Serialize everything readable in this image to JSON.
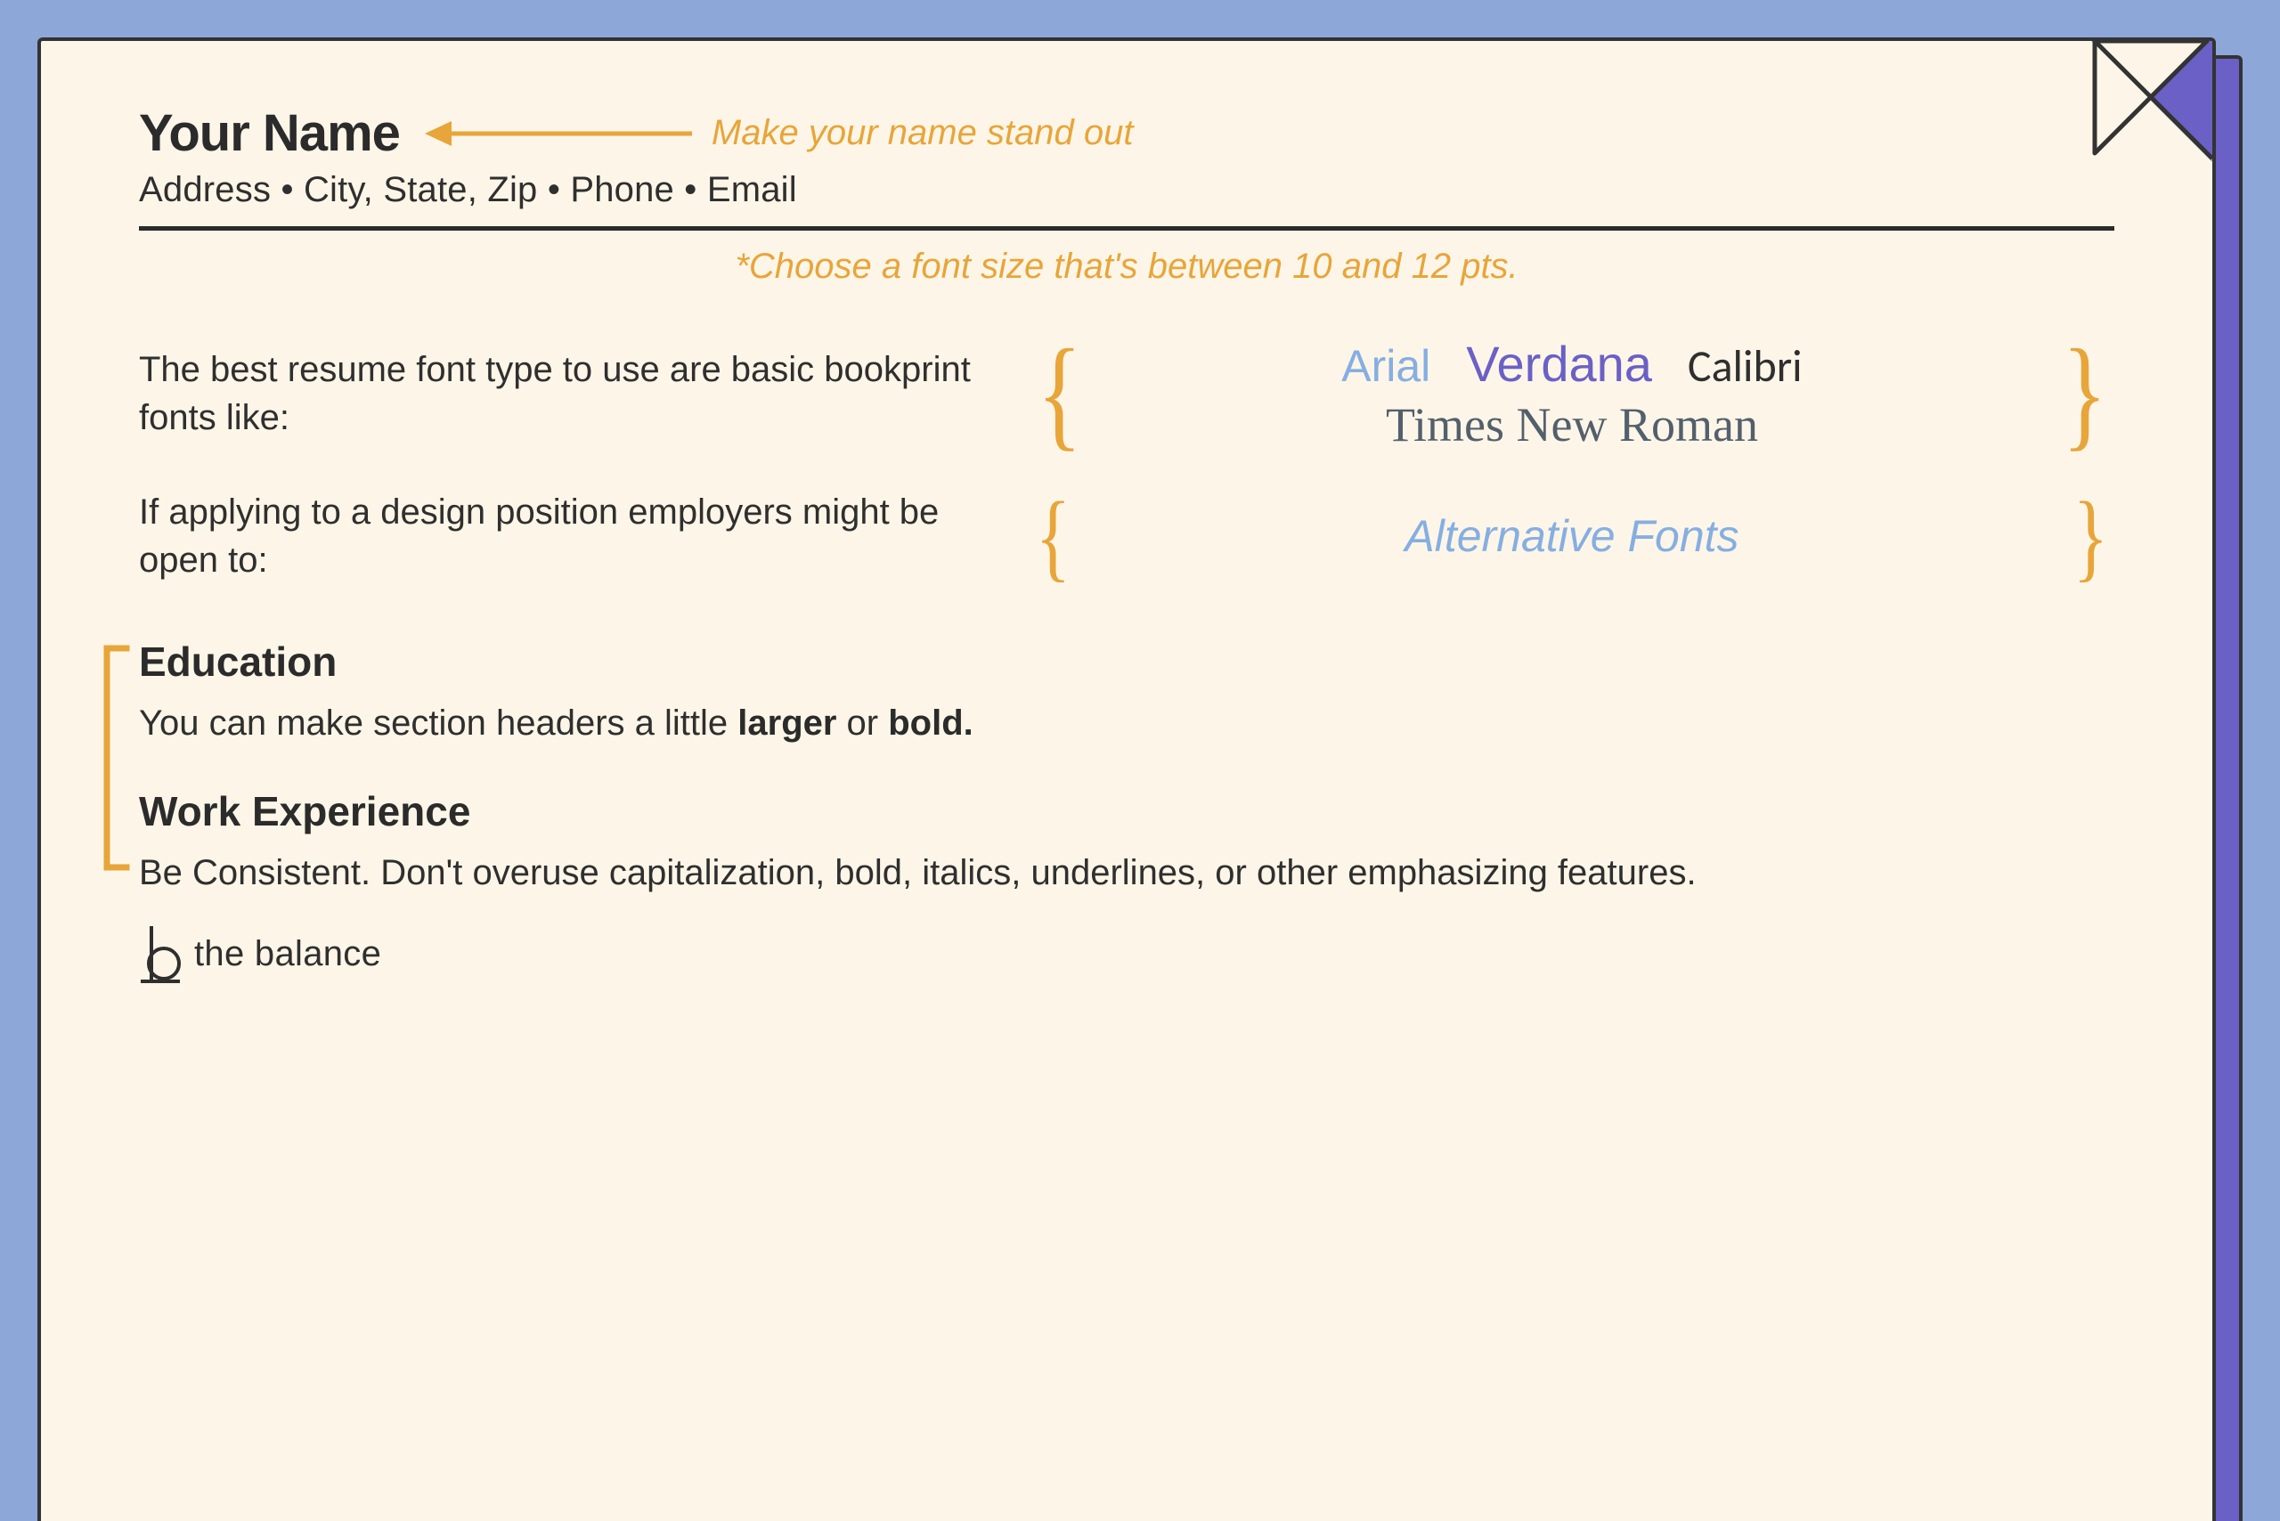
{
  "header": {
    "name": "Your Name",
    "callout": "Make your name stand out",
    "contact": "Address • City, State, Zip • Phone • Email"
  },
  "size_note": "*Choose a font size that's between 10 and 12 pts.",
  "font_block_1": {
    "lead": "The best resume font type to use are basic bookprint fonts like:",
    "samples": {
      "arial": "Arial",
      "verdana": "Verdana",
      "calibri": "Calibri",
      "times": "Times New Roman"
    }
  },
  "font_block_2": {
    "lead": "If applying to a design position employers might be open to:",
    "sample": "Alternative Fonts"
  },
  "sections": {
    "education": {
      "title": "Education",
      "body_prefix": "You can make section headers a little ",
      "body_bold1": "larger",
      "body_mid": " or ",
      "body_bold2": "bold."
    },
    "work": {
      "title": "Work Experience",
      "body": "Be Consistent. Don't overuse capitalization, bold, italics, underlines, or other emphasizing features."
    }
  },
  "logo_text": "the balance",
  "colors": {
    "bg": "#8da7d9",
    "purple": "#6a60c6",
    "paper": "#fdf6e8",
    "accent": "#e8a53a",
    "text": "#2f2f2f"
  }
}
